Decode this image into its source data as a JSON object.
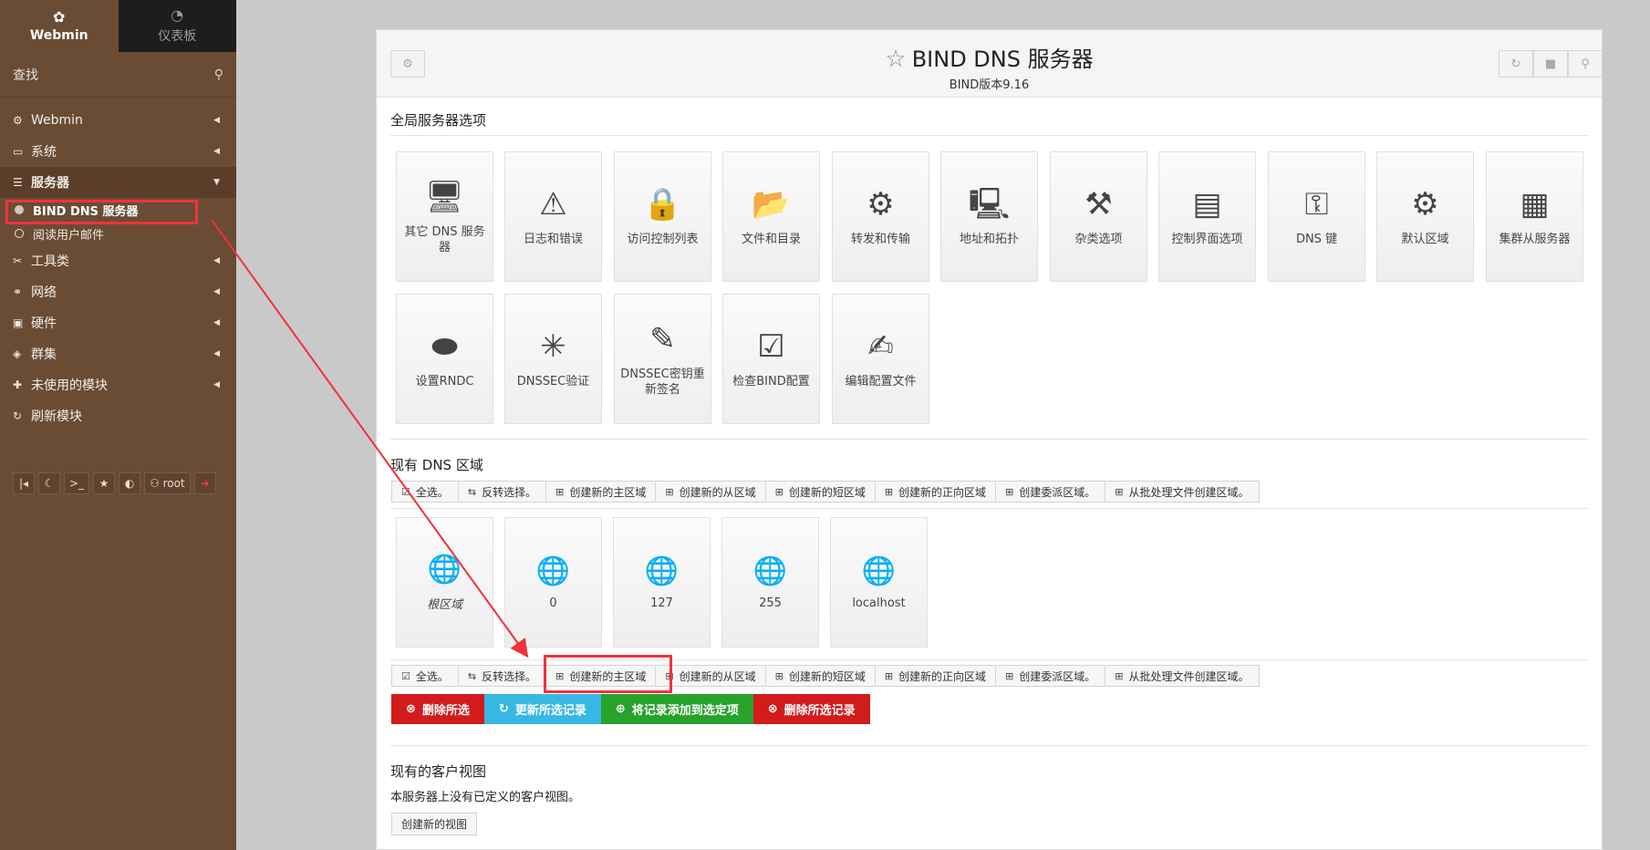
{
  "sidebar": {
    "tabs": [
      {
        "label": "Webmin",
        "icon": "webmin-logo-icon"
      },
      {
        "label": "仪表板",
        "icon": "dashboard-icon"
      }
    ],
    "search_placeholder": "查找",
    "menu": [
      {
        "label": "Webmin",
        "icon": "gear-icon"
      },
      {
        "label": "系统",
        "icon": "laptop-icon"
      },
      {
        "label": "服务器",
        "icon": "server-icon"
      },
      {
        "label": "工具类",
        "icon": "tools-icon"
      },
      {
        "label": "网络",
        "icon": "network-icon"
      },
      {
        "label": "硬件",
        "icon": "hardware-icon"
      },
      {
        "label": "群集",
        "icon": "cluster-icon"
      },
      {
        "label": "未使用的模块",
        "icon": "puzzle-icon"
      },
      {
        "label": "刷新模块",
        "icon": "refresh-icon"
      }
    ],
    "sub_items": [
      {
        "label": "BIND DNS 服务器"
      },
      {
        "label": "阅读用户邮件"
      }
    ],
    "footer_user": "root"
  },
  "header": {
    "title": "BIND DNS 服务器",
    "subtitle": "BIND版本9.16"
  },
  "global_options": {
    "title": "全局服务器选项",
    "tiles": [
      {
        "label": "其它 DNS 服务器",
        "icon": "server-tower-icon"
      },
      {
        "label": "日志和错误",
        "icon": "warning-icon"
      },
      {
        "label": "访问控制列表",
        "icon": "lock-icon"
      },
      {
        "label": "文件和目录",
        "icon": "folder-icon"
      },
      {
        "label": "转发和传输",
        "icon": "gears-icon"
      },
      {
        "label": "地址和拓扑",
        "icon": "computer-icon"
      },
      {
        "label": "杂类选项",
        "icon": "wrench-icon"
      },
      {
        "label": "控制界面选项",
        "icon": "console-icon"
      },
      {
        "label": "DNS 键",
        "icon": "key-icon"
      },
      {
        "label": "默认区域",
        "icon": "gear-icon"
      },
      {
        "label": "集群从服务器",
        "icon": "cluster-servers-icon"
      },
      {
        "label": "设置RNDC",
        "icon": "remote-icon"
      },
      {
        "label": "DNSSEC验证",
        "icon": "dnssec-icon"
      },
      {
        "label": "DNSSEC密钥重新签名",
        "icon": "pen-key-icon"
      },
      {
        "label": "检查BIND配置",
        "icon": "checklist-icon"
      },
      {
        "label": "编辑配置文件",
        "icon": "edit-file-icon"
      }
    ]
  },
  "zones": {
    "title": "现有 DNS 区域",
    "toolbar": [
      {
        "label": "全选。",
        "icon": "check-square-icon"
      },
      {
        "label": "反转选择。",
        "icon": "invert-icon"
      },
      {
        "label": "创建新的主区域",
        "icon": "plus-square-icon"
      },
      {
        "label": "创建新的从区域",
        "icon": "plus-square-icon"
      },
      {
        "label": "创建新的短区域",
        "icon": "plus-square-icon"
      },
      {
        "label": "创建新的正向区域",
        "icon": "plus-square-icon"
      },
      {
        "label": "创建委派区域。",
        "icon": "plus-square-icon"
      },
      {
        "label": "从批处理文件创建区域。",
        "icon": "plus-square-icon"
      }
    ],
    "items": [
      {
        "label": "根区域",
        "icon": "globe-server-icon"
      },
      {
        "label": "0",
        "icon": "globe-icon"
      },
      {
        "label": "127",
        "icon": "globe-icon"
      },
      {
        "label": "255",
        "icon": "globe-icon"
      },
      {
        "label": "localhost",
        "icon": "globe-icon"
      }
    ],
    "actions": [
      {
        "label": "删除所选",
        "icon": "times-circle-icon"
      },
      {
        "label": "更新所选记录",
        "icon": "sync-icon"
      },
      {
        "label": "将记录添加到选定项",
        "icon": "plus-circle-icon"
      },
      {
        "label": "删除所选记录",
        "icon": "times-circle-icon"
      }
    ]
  },
  "views": {
    "title": "现有的客户视图",
    "empty_text": "本服务器上没有已定义的客户视图。",
    "create_button": "创建新的视图"
  },
  "colors": {
    "sidebar": "#6a4c35",
    "annotation_red": "#f0323c",
    "danger": "#d21b1b",
    "info": "#39b7e4",
    "success": "#27a22b"
  }
}
